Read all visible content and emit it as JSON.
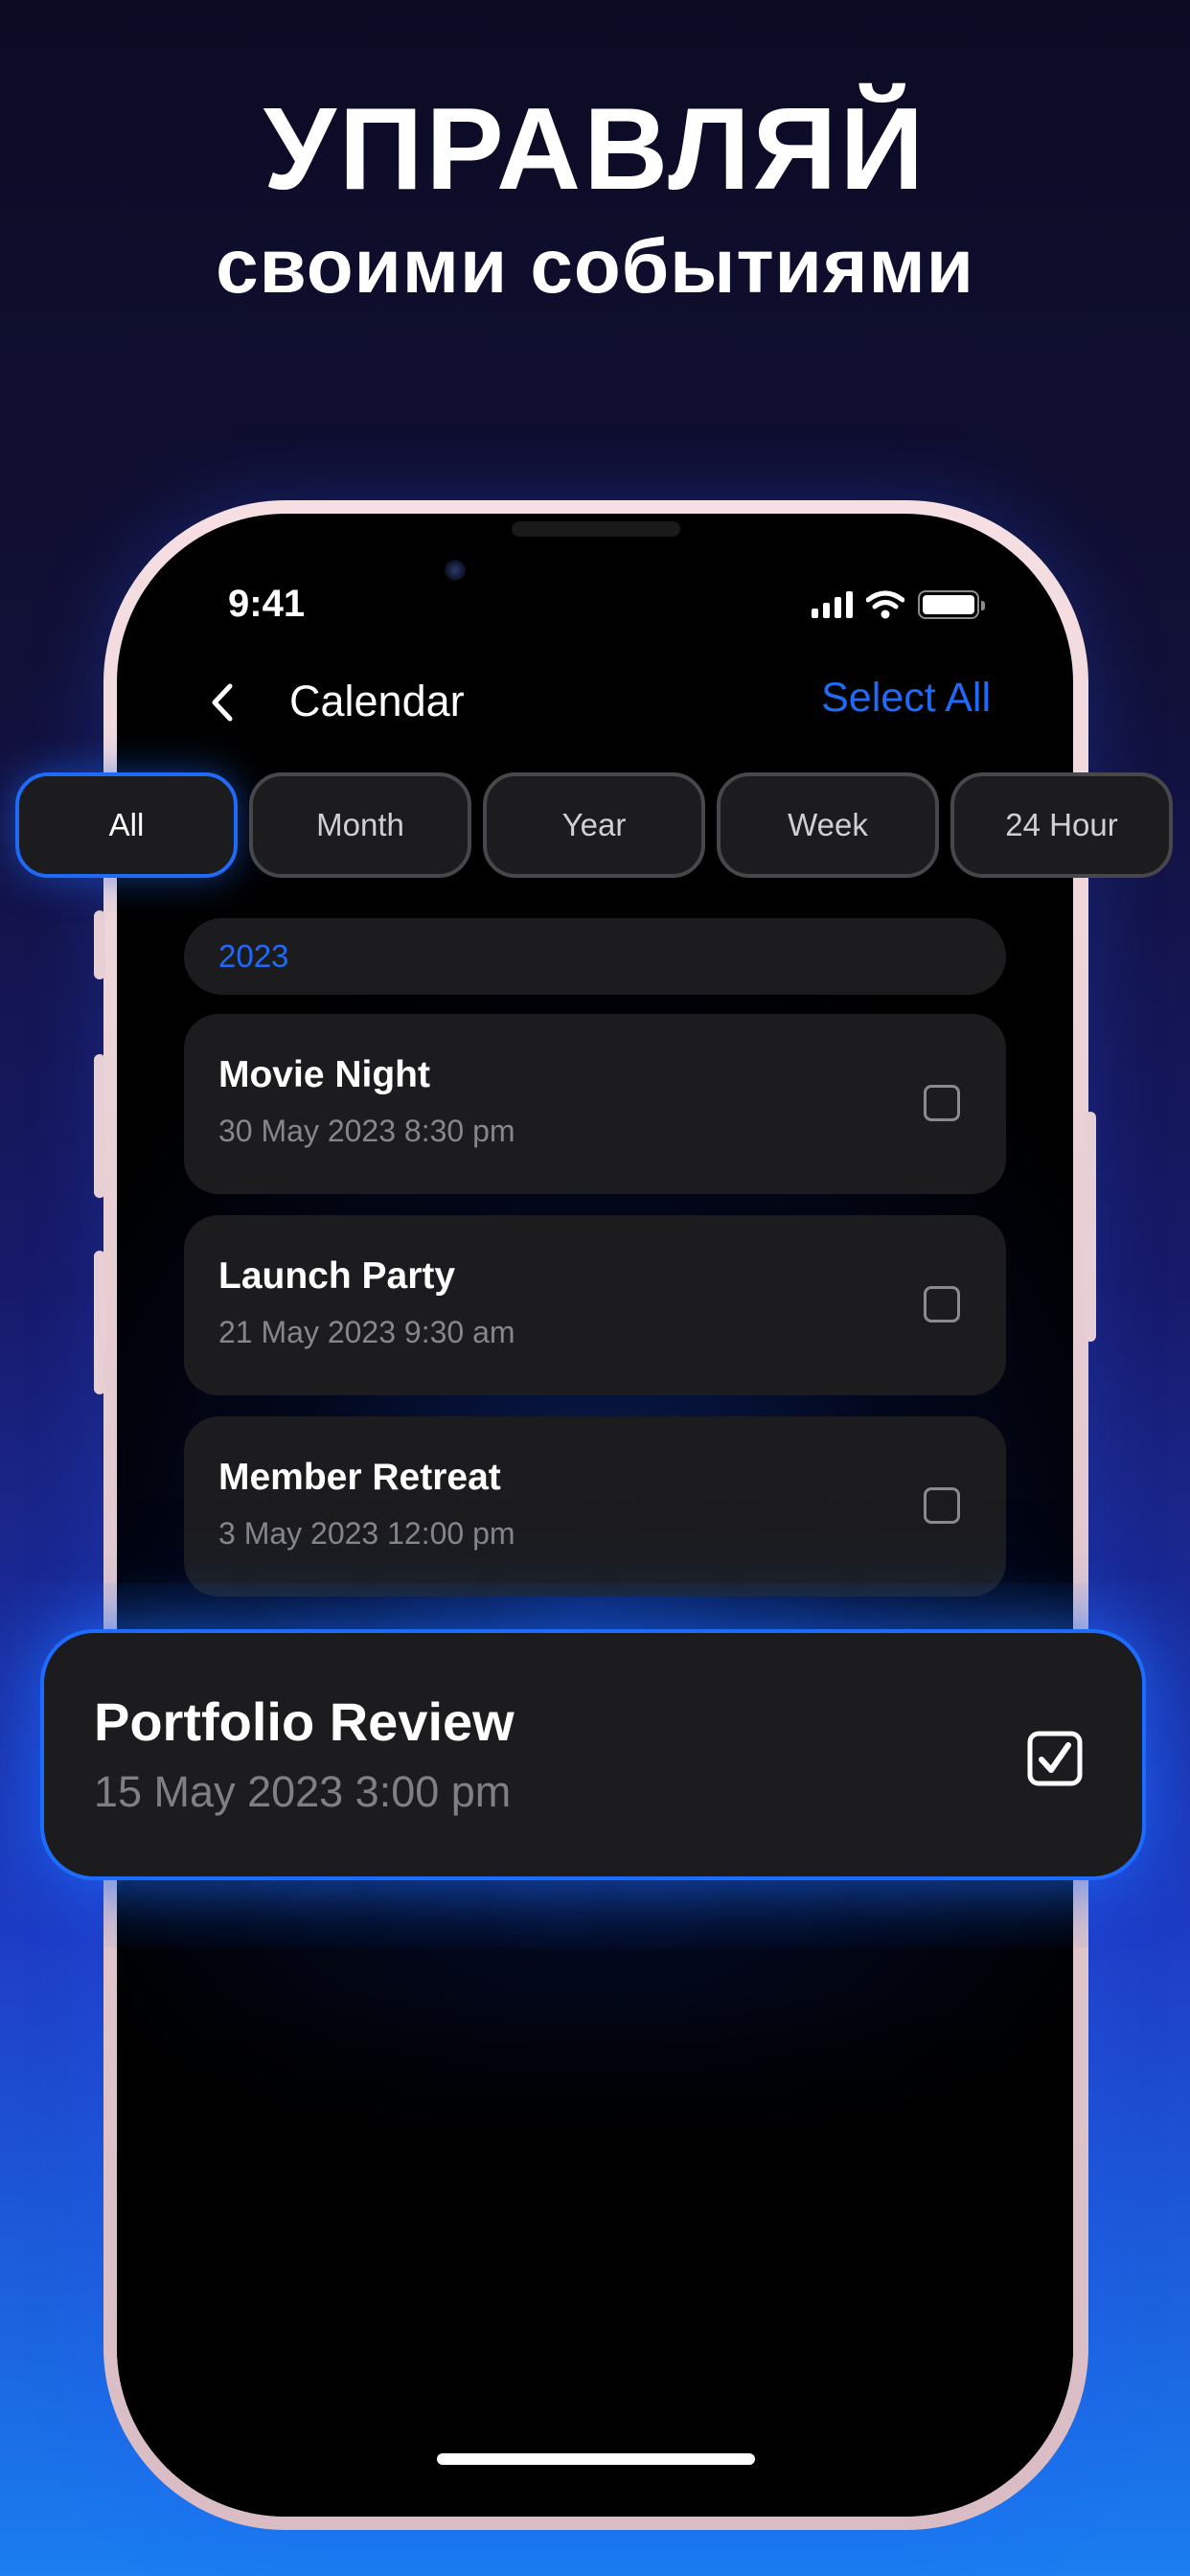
{
  "headline": "УПРАВЛЯЙ",
  "subheadline": "своими событиями",
  "status_bar": {
    "time": "9:41"
  },
  "nav": {
    "title": "Calendar",
    "action": "Select All"
  },
  "filters": [
    {
      "label": "All",
      "active": true
    },
    {
      "label": "Month",
      "active": false
    },
    {
      "label": "Year",
      "active": false
    },
    {
      "label": "Week",
      "active": false
    },
    {
      "label": "24 Hour",
      "active": false
    }
  ],
  "section_year": "2023",
  "events": [
    {
      "title": "Movie Night",
      "date": "30 May 2023 8:30 pm",
      "checked": false
    },
    {
      "title": "Launch Party",
      "date": "21 May 2023 9:30 am",
      "checked": false
    },
    {
      "title": "Member Retreat",
      "date": "3 May 2023 12:00 pm",
      "checked": false
    }
  ],
  "featured_event": {
    "title": "Portfolio Review",
    "date": "15 May 2023 3:00 pm",
    "checked": true
  },
  "colors": {
    "accent": "#1f6af6",
    "card": "#1c1c1e",
    "muted_text": "#86868c"
  }
}
